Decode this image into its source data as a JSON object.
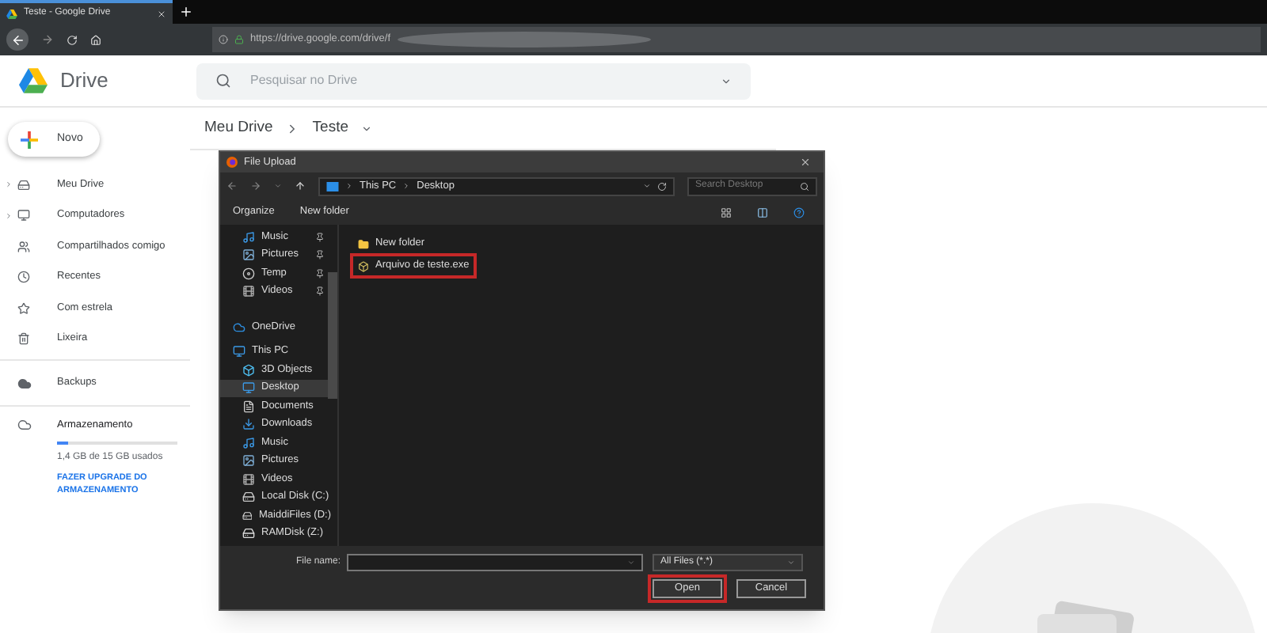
{
  "browser": {
    "tab": {
      "title": "Teste - Google Drive",
      "selected": true
    },
    "url": "https://drive.google.com/drive/f"
  },
  "header": {
    "app_name": "Drive",
    "search": {
      "placeholder": "Pesquisar no Drive"
    }
  },
  "new_button": "Novo",
  "sidebar": {
    "items": [
      {
        "label": "Meu Drive",
        "expandable": true
      },
      {
        "label": "Computadores",
        "expandable": true
      },
      {
        "label": "Compartilhados comigo",
        "expandable": false
      },
      {
        "label": "Recentes",
        "expandable": false
      },
      {
        "label": "Com estrela",
        "expandable": false
      },
      {
        "label": "Lixeira",
        "expandable": false
      }
    ],
    "backups": "Backups",
    "storage": {
      "title": "Armazenamento",
      "level": 0.09,
      "usage": "1,4 GB de 15 GB usados",
      "upgrade": "FAZER UPGRADE DO ARMAZENAMENTO"
    }
  },
  "breadcrumb": [
    "Meu Drive",
    "Teste"
  ],
  "dialog": {
    "title": "File Upload",
    "path": [
      "This PC",
      "Desktop"
    ],
    "search": {
      "placeholder": "Search Desktop"
    },
    "toolbar": [
      "Organize",
      "New folder"
    ],
    "quick_access": [
      {
        "label": "Music",
        "pinned": true
      },
      {
        "label": "Pictures",
        "pinned": true
      },
      {
        "label": "Temp",
        "pinned": true
      },
      {
        "label": "Videos",
        "pinned": true
      }
    ],
    "tree": [
      {
        "label": "OneDrive",
        "selected": false
      },
      {
        "label": "This PC",
        "selected": false,
        "children": [
          {
            "label": "3D Objects",
            "selected": false
          },
          {
            "label": "Desktop",
            "selected": true
          },
          {
            "label": "Documents",
            "selected": false
          },
          {
            "label": "Downloads",
            "selected": false
          },
          {
            "label": "Music",
            "selected": false
          },
          {
            "label": "Pictures",
            "selected": false
          },
          {
            "label": "Videos",
            "selected": false
          },
          {
            "label": "Local Disk (C:)",
            "selected": false
          },
          {
            "label": "MaiddiFiles (D:)",
            "selected": false
          },
          {
            "label": "RAMDisk (Z:)",
            "selected": false
          }
        ]
      }
    ],
    "files": [
      {
        "name": "New folder",
        "kind": "folder",
        "highlighted": false
      },
      {
        "name": "Arquivo de teste.exe",
        "kind": "exe",
        "highlighted": true
      }
    ],
    "file_name_label": "File name:",
    "file_type": "All Files (*.*)",
    "buttons": [
      {
        "label": "Open",
        "highlighted": true
      },
      {
        "label": "Cancel",
        "highlighted": false
      }
    ]
  }
}
